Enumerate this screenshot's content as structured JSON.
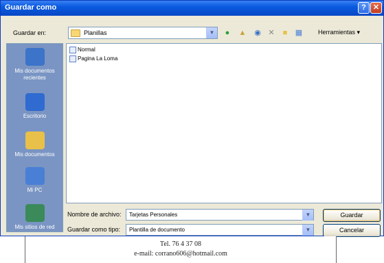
{
  "dialog": {
    "title": "Guardar como",
    "help_glyph": "?",
    "close_glyph": "✕"
  },
  "lookin": {
    "label": "Guardar en:",
    "value": "Planillas"
  },
  "toolbar": {
    "icons": [
      "back-icon",
      "up-folder-icon",
      "search-web-icon",
      "delete-icon",
      "new-folder-icon",
      "views-icon"
    ],
    "tools_label": "Herramientas ▾"
  },
  "places": [
    {
      "label_line1": "Mis documentos",
      "label_line2": "recientes",
      "color": "#3b74c9"
    },
    {
      "label_line1": "Escritorio",
      "label_line2": "",
      "color": "#2f6bd0"
    },
    {
      "label_line1": "Mis documentos",
      "label_line2": "",
      "color": "#e8c04a"
    },
    {
      "label_line1": "Mi PC",
      "label_line2": "",
      "color": "#4a7fd6"
    },
    {
      "label_line1": "Mis sitios de red",
      "label_line2": "",
      "color": "#3a8a5a"
    }
  ],
  "files": [
    {
      "name": "Normal"
    },
    {
      "name": "Pagina La Loma"
    }
  ],
  "filename": {
    "label": "Nombre de archivo:",
    "value": "Tarjetas Personales"
  },
  "filetype": {
    "label": "Guardar como tipo:",
    "value": "Plantilla de documento"
  },
  "buttons": {
    "save": "Guardar",
    "cancel": "Cancelar"
  },
  "document": {
    "line1": "Tel. 76 4 37 08",
    "line2": "e-mail: corrano606@hotmail.com"
  }
}
